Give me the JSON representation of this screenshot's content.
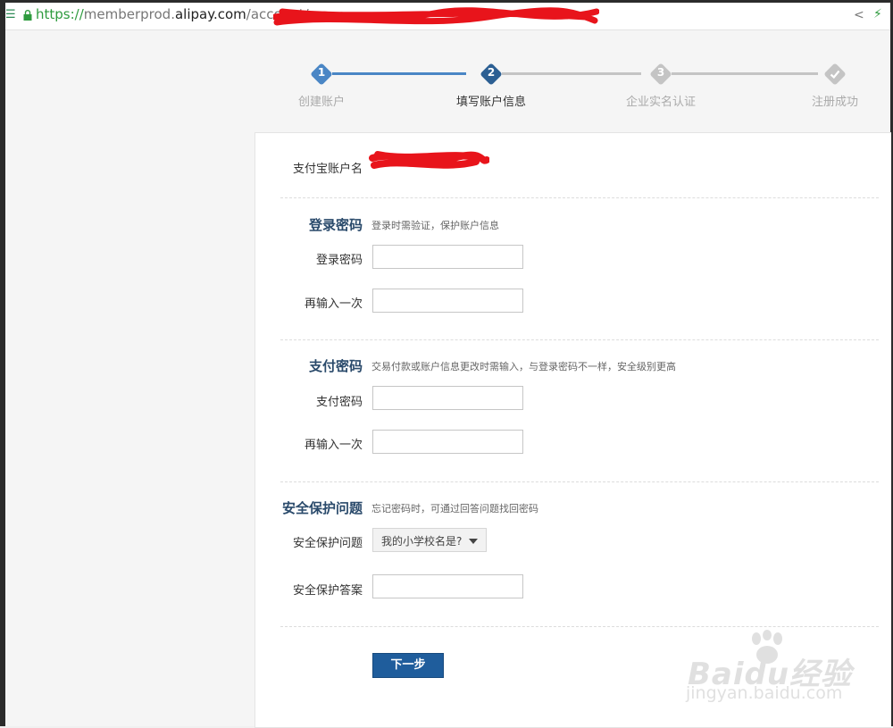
{
  "browser": {
    "url_scheme": "https://",
    "url_host_prefix": "memberprod.",
    "url_domain": "alipay.com",
    "url_path": "/account/re"
  },
  "stepper": {
    "steps": [
      {
        "number": "1",
        "label": "创建账户",
        "state": "done"
      },
      {
        "number": "2",
        "label": "填写账户信息",
        "state": "active"
      },
      {
        "number": "3",
        "label": "企业实名认证",
        "state": "pending"
      },
      {
        "number": "",
        "label": "注册成功",
        "state": "pending"
      }
    ]
  },
  "form": {
    "account_name_label": "支付宝账户名",
    "login_section": {
      "title": "登录密码",
      "hint": "登录时需验证，保护账户信息",
      "password_label": "登录密码",
      "confirm_label": "再输入一次"
    },
    "pay_section": {
      "title": "支付密码",
      "hint": "交易付款或账户信息更改时需输入，与登录密码不一样，安全级别更高",
      "password_label": "支付密码",
      "confirm_label": "再输入一次"
    },
    "security_section": {
      "title": "安全保护问题",
      "hint": "忘记密码时，可通过回答问题找回密码",
      "question_label": "安全保护问题",
      "question_value": "我的小学校名是?",
      "answer_label": "安全保护答案"
    },
    "next_button": "下一步"
  },
  "watermark": {
    "brand": "Baidu经验",
    "site": "jingyan.baidu.com"
  },
  "colors": {
    "step_done": "#4a86c5",
    "step_active": "#2c5f93",
    "step_pending": "#c4c4c4",
    "section_title": "#2a4a6b",
    "button": "#1f5d9c",
    "redaction": "#e8141b"
  }
}
